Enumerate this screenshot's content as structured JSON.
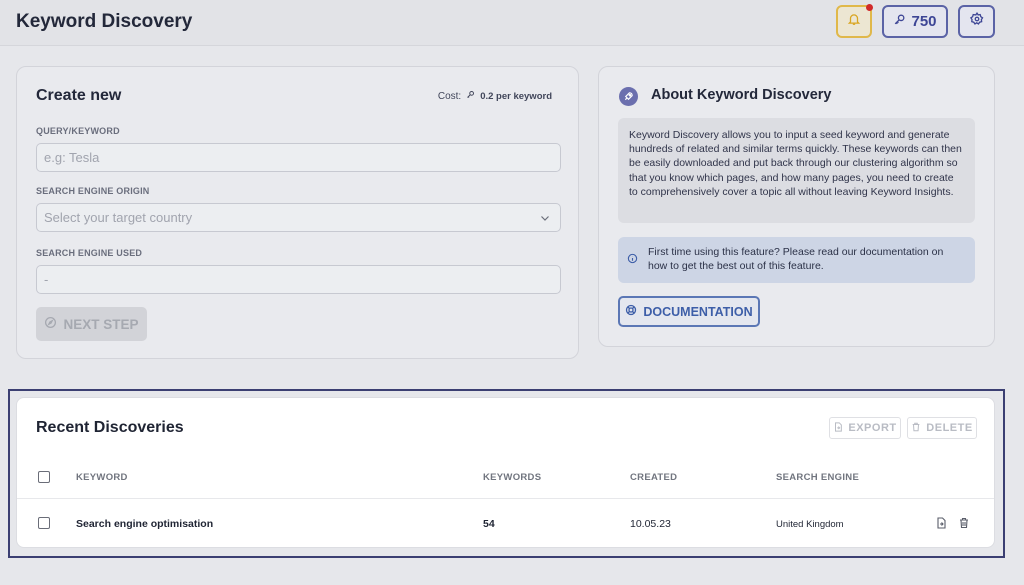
{
  "header": {
    "title": "Keyword Discovery",
    "credits": "750"
  },
  "create": {
    "title": "Create new",
    "cost_label": "Cost:",
    "cost_value": "0.2 per keyword",
    "query_label": "QUERY/KEYWORD",
    "query_placeholder": "e.g: Tesla",
    "origin_label": "SEARCH ENGINE ORIGIN",
    "origin_placeholder": "Select your target country",
    "engine_label": "SEARCH ENGINE USED",
    "engine_value": "-",
    "next_button": "NEXT STEP"
  },
  "about": {
    "title": "About Keyword Discovery",
    "description": "Keyword Discovery allows you to input a seed keyword and generate hundreds of related and similar terms quickly. These keywords can then be easily downloaded and put back through our clustering algorithm so that you know which pages, and how many pages, you need to create to comprehensively cover a topic all without leaving Keyword Insights.",
    "info": "First time using this feature? Please read our documentation on how to get the best out of this feature.",
    "doc_button": "DOCUMENTATION"
  },
  "recent": {
    "title": "Recent Discoveries",
    "export_button": "EXPORT",
    "delete_button": "DELETE",
    "columns": [
      "KEYWORD",
      "KEYWORDS",
      "CREATED",
      "SEARCH ENGINE"
    ],
    "rows": [
      {
        "keyword": "Search engine optimisation",
        "keywords": "54",
        "created": "10.05.23",
        "search_engine": "United Kingdom"
      }
    ]
  },
  "colors": {
    "accent": "#3d4595",
    "notification": "#d12a2a",
    "highlight_frame": "#3b3f72"
  }
}
